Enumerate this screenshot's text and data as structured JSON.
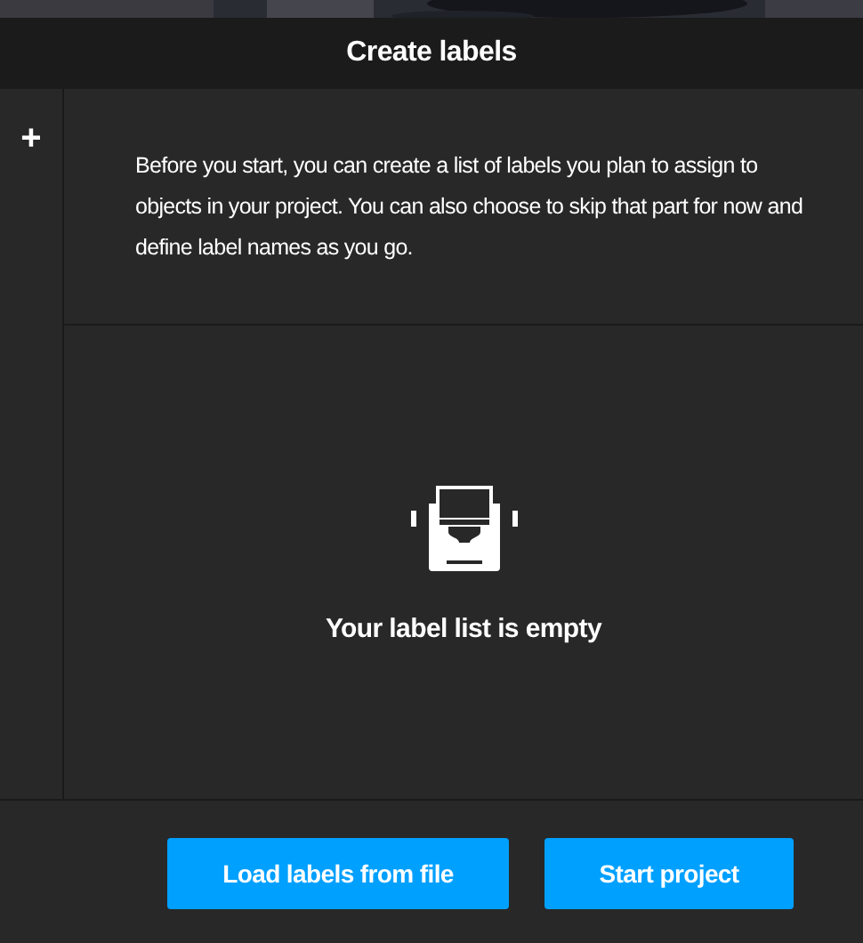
{
  "dialog": {
    "title": "Create labels"
  },
  "sidebar": {
    "add_button": "+"
  },
  "intro": "Before you start, you can create a list of labels you plan to assign to objects in your project. You can also choose to skip that part for now and define label names as you go.",
  "empty_state": {
    "message": "Your label list is empty"
  },
  "buttons": [
    "Load labels from file",
    "Start project"
  ]
}
